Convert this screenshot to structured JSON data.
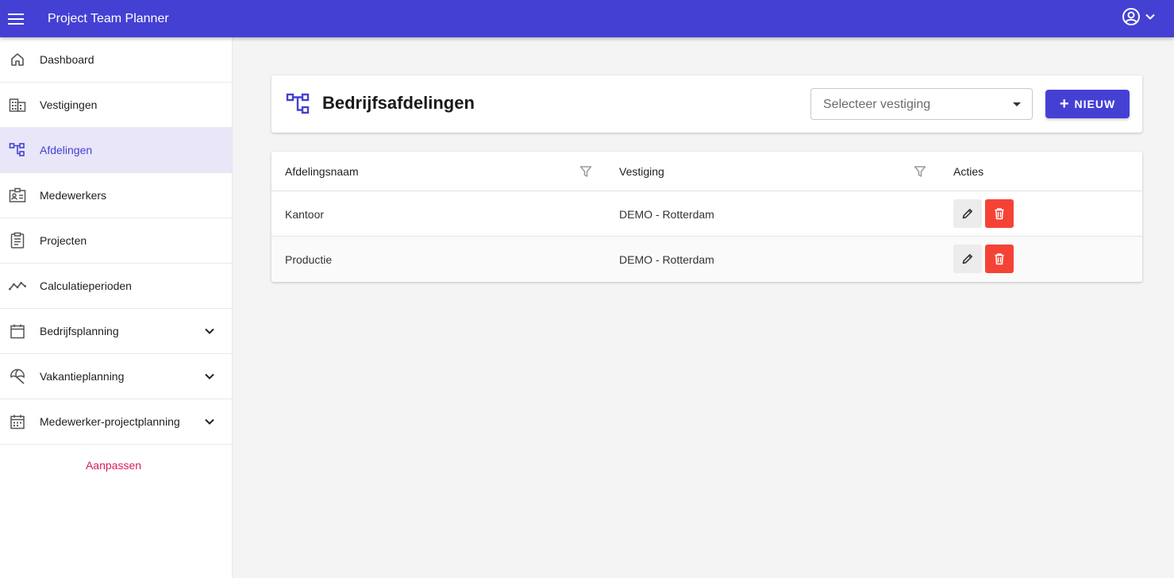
{
  "app": {
    "title": "Project Team Planner"
  },
  "sidebar": {
    "items": [
      {
        "label": "Dashboard",
        "icon": "home-icon"
      },
      {
        "label": "Vestigingen",
        "icon": "building-icon"
      },
      {
        "label": "Afdelingen",
        "icon": "hierarchy-icon",
        "active": true
      },
      {
        "label": "Medewerkers",
        "icon": "id-card-icon"
      },
      {
        "label": "Projecten",
        "icon": "clipboard-icon"
      },
      {
        "label": "Calculatieperioden",
        "icon": "trend-icon"
      },
      {
        "label": "Bedrijfsplanning",
        "icon": "calendar-icon",
        "expandable": true
      },
      {
        "label": "Vakantieplanning",
        "icon": "umbrella-icon",
        "expandable": true
      },
      {
        "label": "Medewerker-projectplanning",
        "icon": "calendar-grid-icon",
        "expandable": true
      }
    ],
    "customize_label": "Aanpassen"
  },
  "header": {
    "title": "Bedrijfsafdelingen",
    "select_placeholder": "Selecteer vestiging",
    "new_button_label": "NIEUW"
  },
  "table": {
    "columns": [
      "Afdelingsnaam",
      "Vestiging",
      "Acties"
    ],
    "rows": [
      {
        "name": "Kantoor",
        "location": "DEMO - Rotterdam"
      },
      {
        "name": "Productie",
        "location": "DEMO - Rotterdam"
      }
    ]
  },
  "colors": {
    "primary": "#4540d4",
    "active_bg": "#e8e6f8",
    "delete": "#f44336",
    "link": "#d81b60"
  }
}
